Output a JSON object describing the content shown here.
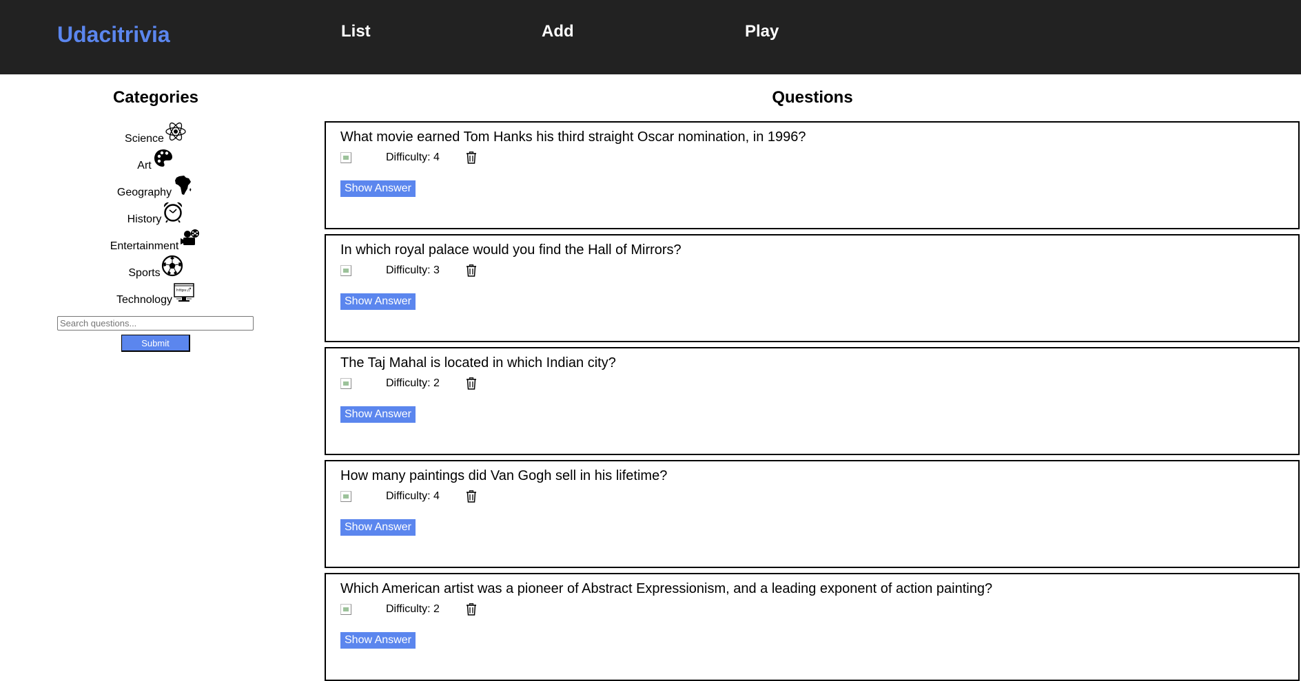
{
  "header": {
    "brand": "Udacitrivia",
    "nav": {
      "list": "List",
      "add": "Add",
      "play": "Play"
    }
  },
  "sidebar": {
    "title": "Categories",
    "categories": [
      {
        "label": "Science",
        "icon": "atom-icon"
      },
      {
        "label": "Art",
        "icon": "palette-icon"
      },
      {
        "label": "Geography",
        "icon": "africa-map-icon"
      },
      {
        "label": "History",
        "icon": "alarm-clock-icon"
      },
      {
        "label": "Entertainment",
        "icon": "film-camera-icon"
      },
      {
        "label": "Sports",
        "icon": "soccer-ball-icon"
      },
      {
        "label": "Technology",
        "icon": "computer-monitor-icon"
      }
    ],
    "search_placeholder": "Search questions...",
    "search_value": "",
    "submit_label": "Submit"
  },
  "main": {
    "title": "Questions",
    "difficulty_prefix": "Difficulty: ",
    "show_answer_label": "Show Answer",
    "questions": [
      {
        "question": "What movie earned Tom Hanks his third straight Oscar nomination, in 1996?",
        "difficulty": "Difficulty: 4"
      },
      {
        "question": "In which royal palace would you find the Hall of Mirrors?",
        "difficulty": "Difficulty: 3"
      },
      {
        "question": "The Taj Mahal is located in which Indian city?",
        "difficulty": "Difficulty: 2"
      },
      {
        "question": "How many paintings did Van Gogh sell in his lifetime?",
        "difficulty": "Difficulty: 4"
      },
      {
        "question": "Which American artist was a pioneer of Abstract Expressionism, and a leading exponent of action painting?",
        "difficulty": "Difficulty: 2"
      }
    ]
  },
  "colors": {
    "header_bg": "#222222",
    "accent": "#5b86ee"
  }
}
